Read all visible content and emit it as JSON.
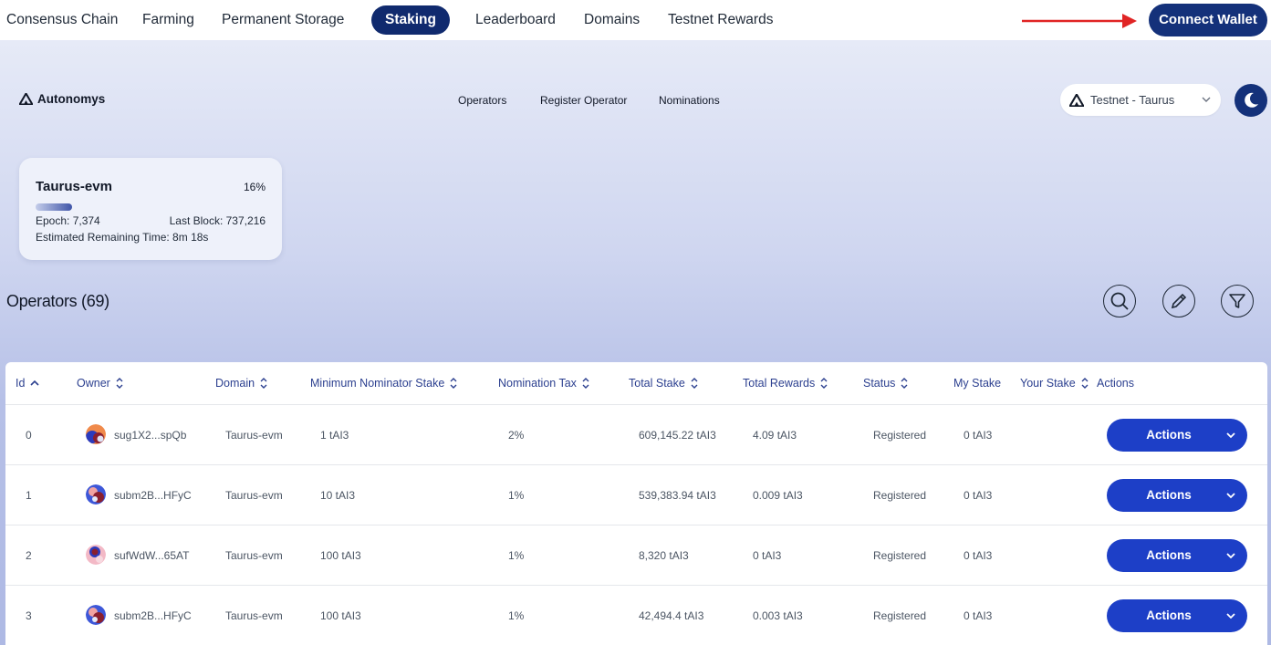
{
  "topnav": {
    "links": [
      "Consensus Chain",
      "Farming",
      "Permanent Storage",
      "Staking",
      "Leaderboard",
      "Domains",
      "Testnet Rewards"
    ],
    "active": "Staking",
    "connect_wallet": "Connect Wallet"
  },
  "brand": {
    "name": "Autonomys"
  },
  "subnav": {
    "links": [
      "Operators",
      "Register Operator",
      "Nominations"
    ]
  },
  "network": {
    "selected": "Testnet - Taurus"
  },
  "epoch_card": {
    "title": "Taurus-evm",
    "progress_percent": "16%",
    "progress_value": 0.16,
    "epoch": "Epoch: 7,374",
    "last_block": "Last Block: 737,216",
    "remaining": "Estimated Remaining Time: 8m 18s"
  },
  "operators": {
    "title": "Operators (69)",
    "columns": [
      "Id",
      "Owner",
      "Domain",
      "Minimum Nominator Stake",
      "Nomination Tax",
      "Total Stake",
      "Total Rewards",
      "Status",
      "My Stake",
      "Your Stake",
      "Actions"
    ],
    "rows": [
      {
        "id": "0",
        "owner": "sug1X2...spQb",
        "domain": "Taurus-evm",
        "min_stake": "1 tAI3",
        "tax": "2%",
        "total_stake": "609,145.22 tAI3",
        "total_rewards": "4.09 tAI3",
        "status": "Registered",
        "my_stake": "0 tAI3",
        "action": "Actions"
      },
      {
        "id": "1",
        "owner": "subm2B...HFyC",
        "domain": "Taurus-evm",
        "min_stake": "10 tAI3",
        "tax": "1%",
        "total_stake": "539,383.94 tAI3",
        "total_rewards": "0.009 tAI3",
        "status": "Registered",
        "my_stake": "0 tAI3",
        "action": "Actions"
      },
      {
        "id": "2",
        "owner": "sufWdW...65AT",
        "domain": "Taurus-evm",
        "min_stake": "100 tAI3",
        "tax": "1%",
        "total_stake": "8,320 tAI3",
        "total_rewards": "0 tAI3",
        "status": "Registered",
        "my_stake": "0 tAI3",
        "action": "Actions"
      },
      {
        "id": "3",
        "owner": "subm2B...HFyC",
        "domain": "Taurus-evm",
        "min_stake": "100 tAI3",
        "tax": "1%",
        "total_stake": "42,494.4 tAI3",
        "total_rewards": "0.003 tAI3",
        "status": "Registered",
        "my_stake": "0 tAI3",
        "action": "Actions"
      }
    ]
  },
  "colors": {
    "accent": "#14317a",
    "action": "#1d3fc7",
    "arrow": "#e02424"
  },
  "icons": [
    "autonomys-logo-icon",
    "chevron-down-icon",
    "moon-icon",
    "search-icon",
    "pencil-icon",
    "filter-icon",
    "sort-icon",
    "red-arrow-icon"
  ]
}
